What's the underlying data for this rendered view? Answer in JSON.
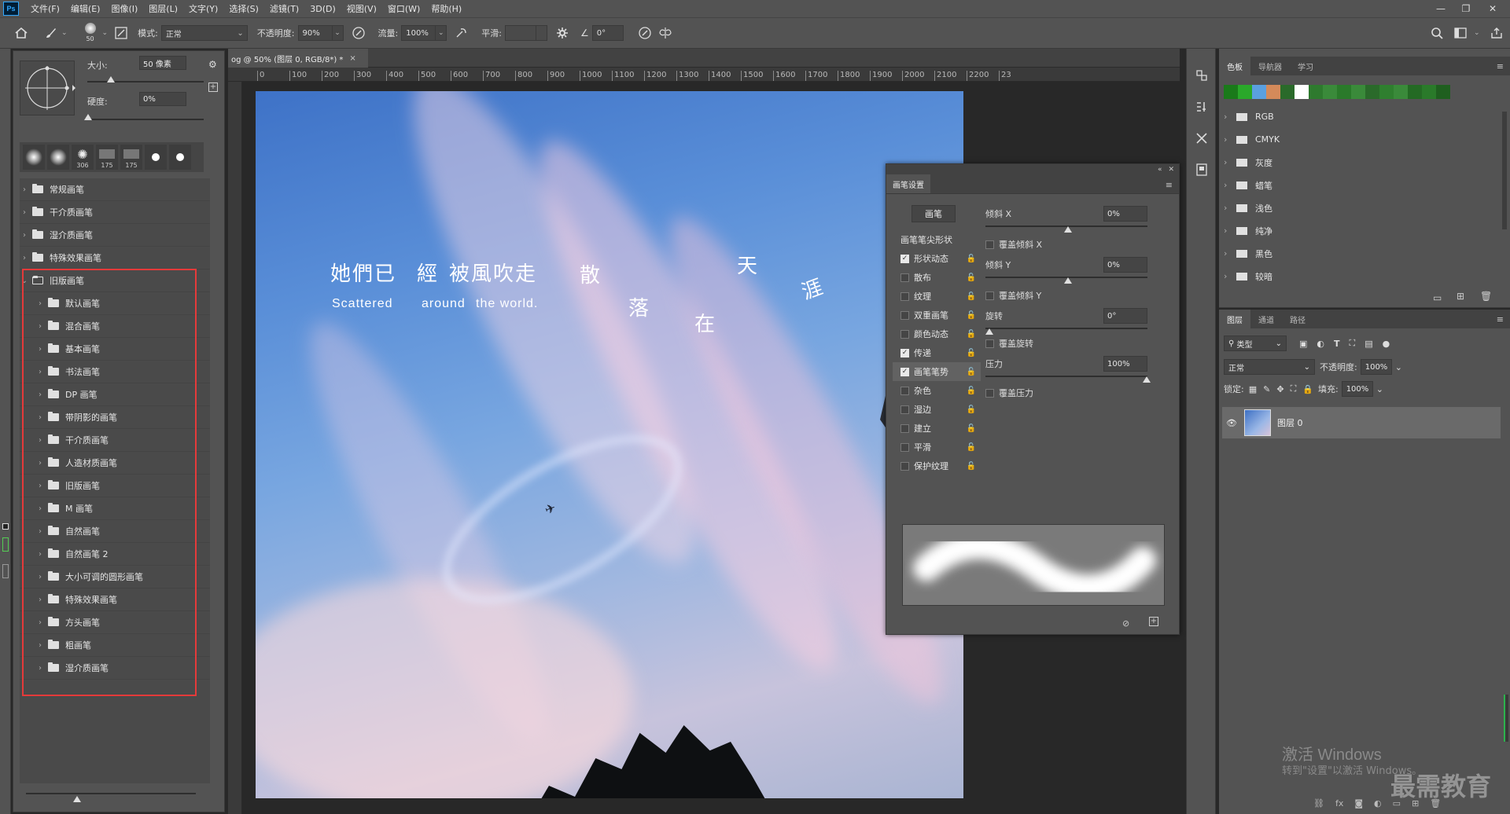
{
  "menubar": {
    "logo": "Ps",
    "items": [
      "文件(F)",
      "编辑(E)",
      "图像(I)",
      "图层(L)",
      "文字(Y)",
      "选择(S)",
      "滤镜(T)",
      "3D(D)",
      "视图(V)",
      "窗口(W)",
      "帮助(H)"
    ]
  },
  "options": {
    "brush_size": "50",
    "mode_label": "模式:",
    "mode_value": "正常",
    "opacity_label": "不透明度:",
    "opacity_value": "90%",
    "flow_label": "流量:",
    "flow_value": "100%",
    "smooth_label": "平滑:",
    "angle_value": "0°"
  },
  "brush_preset": {
    "size_label": "大小:",
    "size_value": "50 像素",
    "hardness_label": "硬度:",
    "hardness_value": "0%",
    "tips": [
      "",
      "",
      "306",
      "175",
      "175",
      "",
      ""
    ],
    "groups": [
      "常规画笔",
      "干介质画笔",
      "湿介质画笔",
      "特殊效果画笔"
    ],
    "open_group": "旧版画笔",
    "subgroups": [
      "默认画笔",
      "混合画笔",
      "基本画笔",
      "书法画笔",
      "DP 画笔",
      "带阴影的画笔",
      "干介质画笔",
      "人造材质画笔",
      "旧版画笔",
      "M 画笔",
      "自然画笔",
      "自然画笔 2",
      "大小可调的圆形画笔",
      "特殊效果画笔",
      "方头画笔",
      "粗画笔",
      "湿介质画笔"
    ]
  },
  "document": {
    "tab_title": "og @ 50% (图层 0, RGB/8*) *",
    "ruler": [
      "0",
      "100",
      "200",
      "300",
      "400",
      "500",
      "600",
      "700",
      "800",
      "900",
      "1000",
      "1100",
      "1200",
      "1300",
      "1400",
      "1500",
      "1600",
      "1700",
      "1800",
      "1900",
      "2000",
      "2100",
      "2200",
      "23"
    ],
    "poem_line1": "她們已",
    "poem_line1b": "經",
    "poem_line1c": "被風吹走",
    "poem_eng1": "Scattered",
    "poem_eng2": "around",
    "poem_eng3": "the world.",
    "poem_chars": [
      "散",
      "落",
      "在",
      "天",
      "涯"
    ]
  },
  "brush_settings": {
    "tab": "画笔设置",
    "btn": "画笔",
    "section": "画笔笔尖形状",
    "items": [
      {
        "label": "形状动态",
        "checked": true
      },
      {
        "label": "散布",
        "checked": false
      },
      {
        "label": "纹理",
        "checked": false
      },
      {
        "label": "双重画笔",
        "checked": false
      },
      {
        "label": "颜色动态",
        "checked": false
      },
      {
        "label": "传递",
        "checked": true
      },
      {
        "label": "画笔笔势",
        "checked": true
      },
      {
        "label": "杂色",
        "checked": false
      },
      {
        "label": "湿边",
        "checked": false
      },
      {
        "label": "建立",
        "checked": false
      },
      {
        "label": "平滑",
        "checked": false
      },
      {
        "label": "保护纹理",
        "checked": false
      }
    ],
    "tilt_x_label": "倾斜 X",
    "tilt_x_value": "0%",
    "override_tilt_x": "覆盖倾斜 X",
    "tilt_y_label": "倾斜 Y",
    "tilt_y_value": "0%",
    "override_tilt_y": "覆盖倾斜 Y",
    "rotation_label": "旋转",
    "rotation_value": "0°",
    "override_rotation": "覆盖旋转",
    "pressure_label": "压力",
    "pressure_value": "100%",
    "override_pressure": "覆盖压力"
  },
  "swatches": {
    "tabs": [
      "色板",
      "导航器",
      "学习"
    ],
    "colors": [
      "#1a7a1a",
      "#2aa82a",
      "#5aa0e0",
      "#d48a5a",
      "#2a6a2a",
      "#ffffff",
      "#2e7a2e",
      "#3a8a3a",
      "#2a7a2a",
      "#3a8a3a",
      "#2a6a2a",
      "#2f7f2f",
      "#3a8a3a",
      "#246a24",
      "#2a7a2a",
      "#1f5f1f"
    ],
    "folders": [
      "RGB",
      "CMYK",
      "灰度",
      "蜡笔",
      "浅色",
      "纯净",
      "黑色",
      "较暗"
    ]
  },
  "layers": {
    "tabs": [
      "图层",
      "通道",
      "路径"
    ],
    "kind": "类型",
    "blend": "正常",
    "opacity_label": "不透明度:",
    "opacity_value": "100%",
    "lock_label": "锁定:",
    "fill_label": "填充:",
    "fill_value": "100%",
    "layer_name": "图层 0"
  },
  "watermark": {
    "line1": "激活 Windows",
    "line2": "转到\"设置\"以激活 Windows。",
    "brand": "最需教育"
  }
}
